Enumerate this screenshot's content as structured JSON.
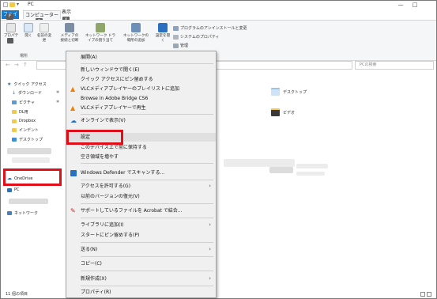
{
  "window": {
    "title": "PC",
    "minimize": "—",
    "maximize": "□"
  },
  "ribbon_tabs": {
    "file": "ファイル",
    "file_key": "F",
    "computer": "コンピューター",
    "computer_key": "C",
    "view": "表示",
    "view_key": "V"
  },
  "ribbon": {
    "properties": "プロパティ",
    "open": "開く",
    "rename": "名前の変更",
    "media_access": "メディアの接続と切断",
    "map_drive": "ネットワーク ドライブの割り当て",
    "add_location": "ネットワークの場所の追加",
    "open_settings": "設定を開く",
    "uninstall": "プログラムのアンインストールと変更",
    "sys_props": "システムのプロパティ",
    "manage": "管理",
    "group_location": "場所"
  },
  "address": {
    "search_placeholder": "PCの検索"
  },
  "nav": {
    "quick_access": "クイック アクセス",
    "downloads": "ダウンロード",
    "pictures": "ピクチャ",
    "dl": "DL用",
    "dropbox": "Dropbox",
    "index": "インデント",
    "desktop": "デスクトップ",
    "onedrive": "OneDrive",
    "pc": "PC",
    "network": "ネットワーク"
  },
  "content": {
    "desktop": "デスクトップ",
    "video": "ビデオ"
  },
  "status": {
    "items": "11 個の項目"
  },
  "context_menu": {
    "expand": "展開(A)",
    "open_new_window": "新しいウィンドウで開く(E)",
    "pin_quick": "クイック アクセスにピン留めする",
    "vlc_playlist": "VLCメディアプレイヤーのプレイリストに追加",
    "bridge": "Browse in Adobe Bridge CS6",
    "vlc_play": "VLCメディアプレイヤーで再生",
    "online": "オンラインで表示(V)",
    "settings": "設定",
    "always_keep": "このデバイス上で常に保持する",
    "free_space": "空き領域を増やす",
    "defender": "Windows Defender でスキャンする...",
    "give_access": "アクセスを許可する(G)",
    "restore": "以前のバージョンの復元(V)",
    "acrobat": "サポートしているファイルを Acrobat で結合...",
    "library": "ライブラリに追加(I)",
    "pin_start": "スタートにピン留めする(P)",
    "send_to": "送る(N)",
    "copy": "コピー(C)",
    "new": "新規作成(X)",
    "properties": "プロパティ(R)"
  },
  "colors": {
    "highlight_box": "#e0101a",
    "file_tab": "#1979ca",
    "folder": "#f2c94c"
  }
}
